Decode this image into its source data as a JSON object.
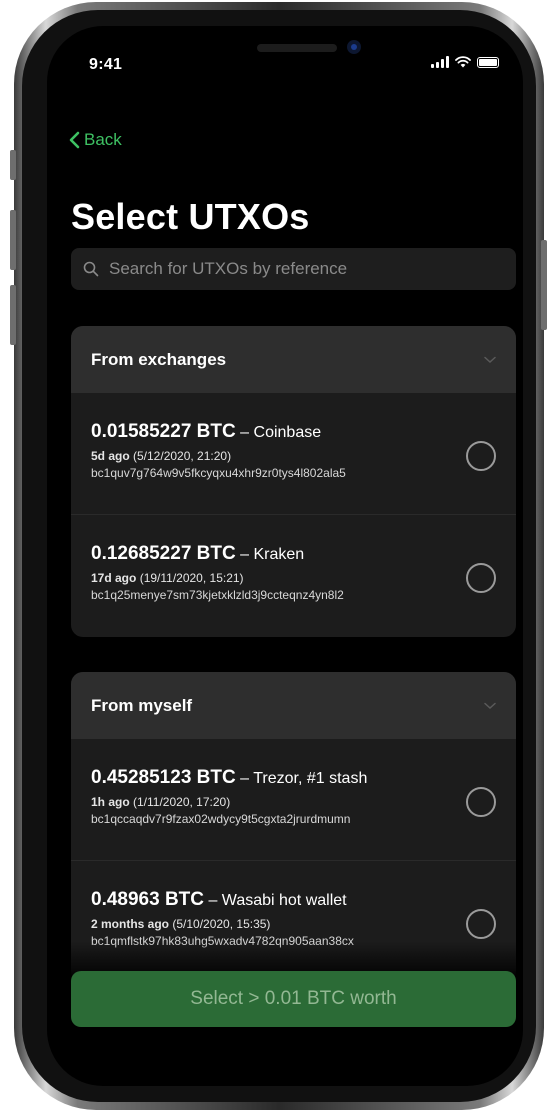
{
  "status_bar": {
    "time": "9:41"
  },
  "nav": {
    "back_label": "Back"
  },
  "page": {
    "title": "Select UTXOs"
  },
  "search": {
    "placeholder": "Search for UTXOs by reference"
  },
  "groups": [
    {
      "title": "From exchanges",
      "items": [
        {
          "amount": "0.01585227 BTC",
          "source": " – Coinbase",
          "age": "5d ago",
          "date": " (5/12/2020, 21:20)",
          "address": "bc1quv7g764w9v5fkcyqxu4xhr9zr0tys4l802ala5"
        },
        {
          "amount": "0.12685227 BTC",
          "source": " – Kraken",
          "age": "17d ago",
          "date": " (19/11/2020, 15:21)",
          "address": "bc1q25menye7sm73kjetxklzld3j9ccteqnz4yn8l2"
        }
      ]
    },
    {
      "title": "From myself",
      "items": [
        {
          "amount": "0.45285123 BTC",
          "source": " – Trezor, #1 stash",
          "age": "1h ago",
          "date": " (1/11/2020, 17:20)",
          "address": "bc1qccaqdv7r9fzax02wdycy9t5cgxta2jrurdmumn"
        },
        {
          "amount": "0.48963 BTC",
          "source": " – Wasabi hot wallet",
          "age": "2 months ago",
          "date": " (5/10/2020, 15:35)",
          "address": "bc1qmflstk97hk83uhg5wxadv4782qn905aan38cx"
        }
      ]
    }
  ],
  "cta": {
    "label": "Select > 0.01 BTC worth"
  },
  "colors": {
    "accent": "#3ec163",
    "cta_bg": "#2b6b36",
    "background": "#000000",
    "card_header": "#2e2e2e",
    "card_body": "#1c1c1c"
  }
}
